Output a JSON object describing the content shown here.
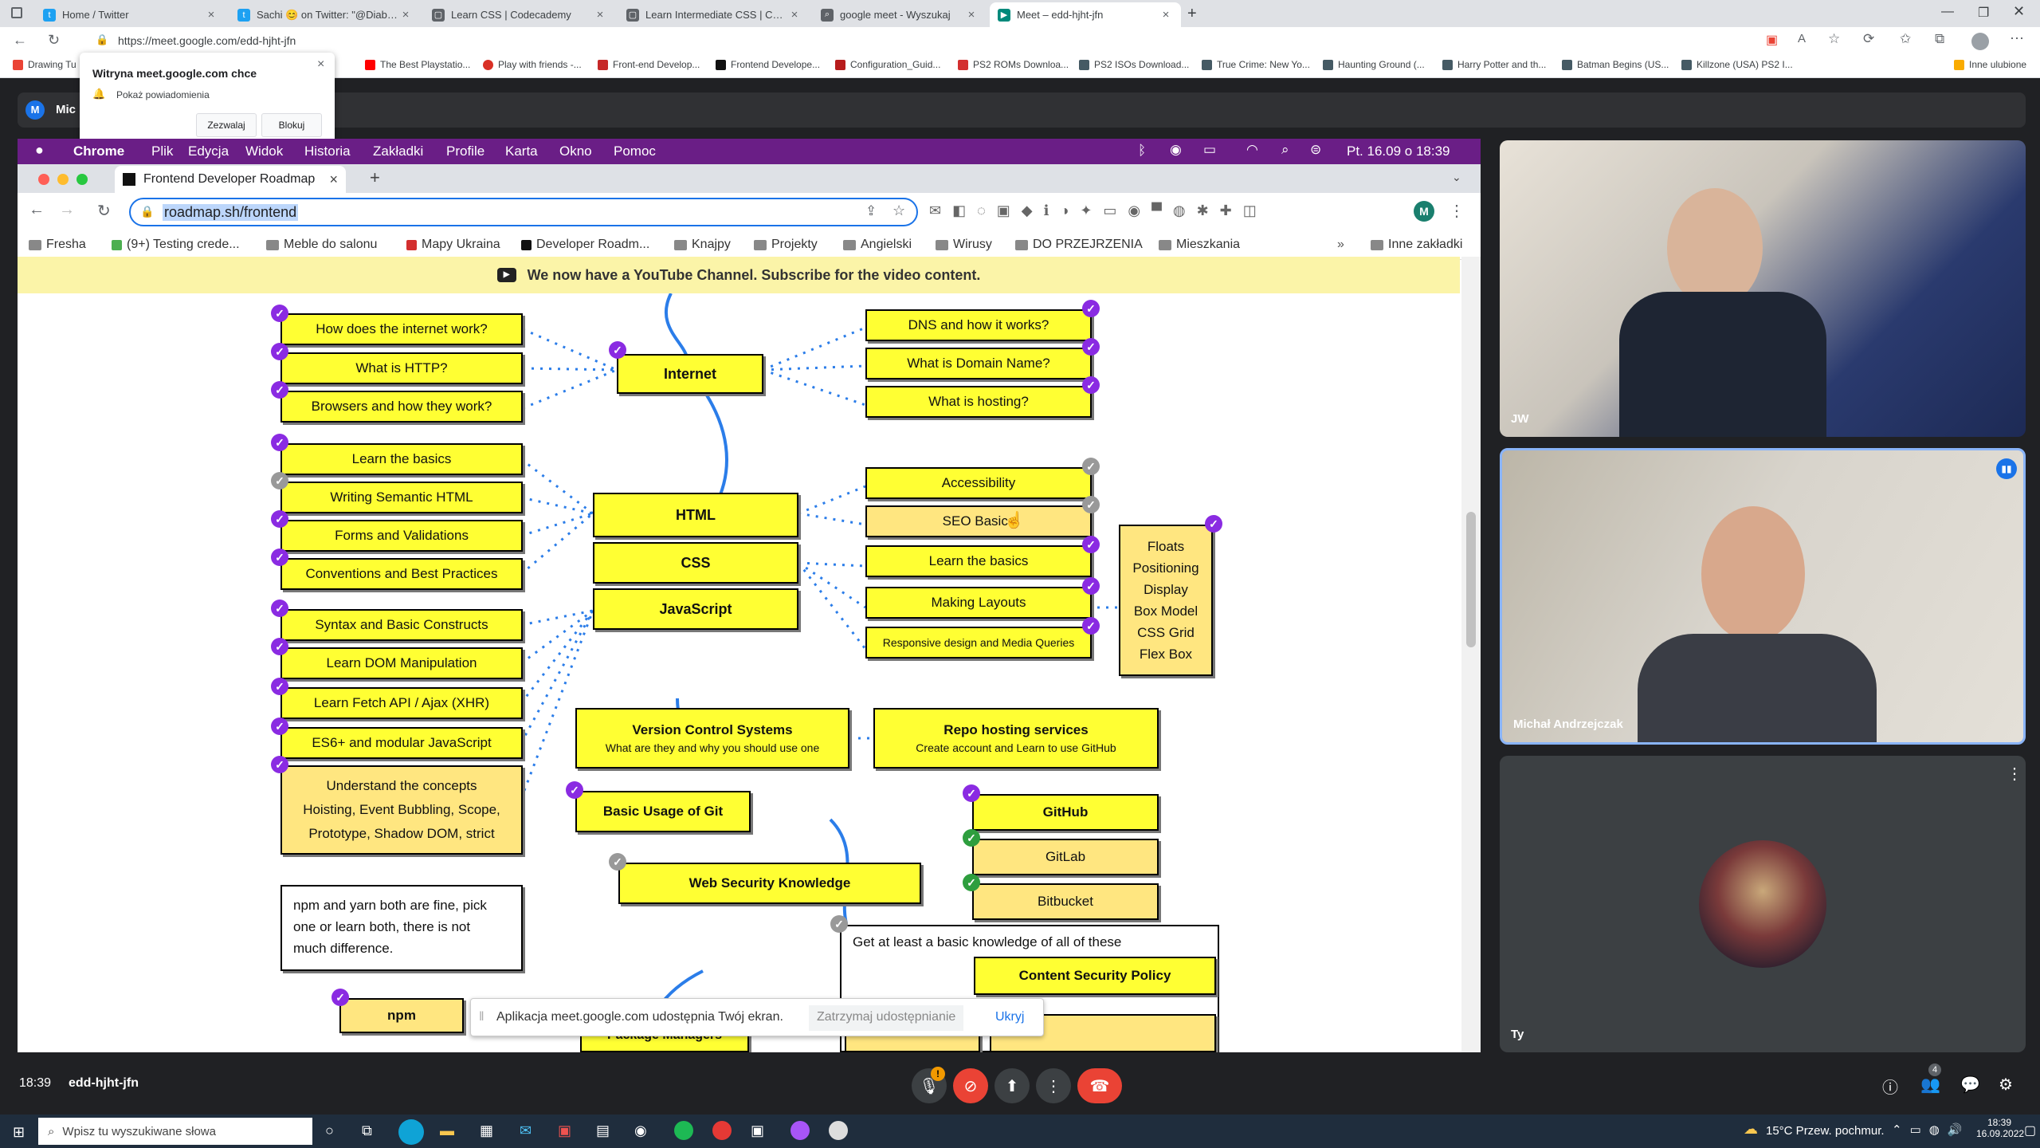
{
  "outer_tabs": [
    {
      "title": "Home / Twitter",
      "fav": "#1da1f2",
      "glyph": "t"
    },
    {
      "title": "Sachi 😊 on Twitter: \"@Diabellu",
      "fav": "#1da1f2",
      "glyph": "t"
    },
    {
      "title": "Learn CSS | Codecademy",
      "fav": "#5f6368",
      "glyph": "▢"
    },
    {
      "title": "Learn Intermediate CSS | Codeca",
      "fav": "#5f6368",
      "glyph": "▢"
    },
    {
      "title": "google meet - Wyszukaj",
      "fav": "#5f6368",
      "glyph": "⌕"
    },
    {
      "title": "Meet – edd-hjht-jfn",
      "fav": "#00897b",
      "glyph": "▶"
    }
  ],
  "outer_url": "https://meet.google.com/edd-hjht-jfn",
  "outer_bookmarks": [
    "Drawing Tu",
    "The Best Playstatio...",
    "Play with friends -...",
    "Front-end Develop...",
    "Frontend Develope...",
    "Configuration_Guid...",
    "PS2 ROMs Downloa...",
    "PS2 ISOs Download...",
    "True Crime: New Yo...",
    "Haunting Ground (...",
    "Harry Potter and th...",
    "Batman Begins (US...",
    "Killzone (USA) PS2 I..."
  ],
  "outer_bookmarks_other": "Inne ulubione",
  "notif": {
    "title": "Witryna meet.google.com chce",
    "item": "Pokaż powiadomienia",
    "allow": "Zezwalaj",
    "block": "Blokuj"
  },
  "meet_user_short": "Mic",
  "mac_menu": [
    "Chrome",
    "Plik",
    "Edycja",
    "Widok",
    "Historia",
    "Zakładki",
    "Profile",
    "Karta",
    "Okno",
    "Pomoc"
  ],
  "mac_clock": "Pt. 16.09 o 18:39",
  "inner_tab_title": "Frontend Developer Roadmap",
  "inner_url": "roadmap.sh/frontend",
  "inner_bookmarks": [
    "Fresha",
    "(9+) Testing crede...",
    "Meble do salonu",
    "Mapy Ukraina",
    "Developer Roadm...",
    "Knajpy",
    "Projekty",
    "Angielski",
    "Wirusy",
    "DO PRZEJRZENIA",
    "Mieszkania"
  ],
  "inner_bookmarks_other": "Inne zakładki",
  "yt_banner": "We now have a YouTube Channel. Subscribe for the video content.",
  "roadmap": {
    "internet": "Internet",
    "internet_left": [
      "How does the internet work?",
      "What is HTTP?",
      "Browsers and how they work?"
    ],
    "internet_right": [
      "DNS and how it works?",
      "What is Domain Name?",
      "What is hosting?"
    ],
    "html": "HTML",
    "css": "CSS",
    "js": "JavaScript",
    "html_left": [
      "Learn the basics",
      "Writing Semantic HTML",
      "Forms and Validations",
      "Conventions and Best Practices"
    ],
    "html_right": [
      "Accessibility",
      "SEO Basics"
    ],
    "css_right": [
      "Learn the basics",
      "Making Layouts",
      "Responsive design and Media Queries"
    ],
    "layout_list": [
      "Floats",
      "Positioning",
      "Display",
      "Box Model",
      "CSS Grid",
      "Flex Box"
    ],
    "js_left": [
      "Syntax and Basic Constructs",
      "Learn DOM Manipulation",
      "Learn Fetch API / Ajax (XHR)",
      "ES6+ and modular JavaScript"
    ],
    "js_concepts": [
      "Understand the concepts",
      "Hoisting, Event Bubbling, Scope,",
      "Prototype, Shadow DOM, strict"
    ],
    "vcs_title": "Version Control Systems",
    "vcs_sub": "What are they and why you should use one",
    "repo_title": "Repo hosting services",
    "repo_sub": "Create account and Learn to use GitHub",
    "git_basic": "Basic Usage of Git",
    "hosts": [
      "GitHub",
      "GitLab",
      "Bitbucket"
    ],
    "websec": "Web Security Knowledge",
    "npm_note": [
      "npm and yarn both are fine, pick",
      "one or learn both, there is not",
      "much difference."
    ],
    "npm": "npm",
    "pkg": "Package Managers",
    "sec_note": "Get at least a basic knowledge of all of these",
    "csp": "Content Security Policy"
  },
  "share_bar": {
    "text": "Aplikacja meet.google.com udostępnia Twój ekran.",
    "stop": "Zatrzymaj udostępnianie",
    "hide": "Ukryj"
  },
  "participants": [
    {
      "name": "JW"
    },
    {
      "name": "Michał Andrzejczak"
    },
    {
      "name": "Ty"
    }
  ],
  "meeting": {
    "time": "18:39",
    "code": "edd-hjht-jfn",
    "badge": "4"
  },
  "taskbar": {
    "search": "Wpisz tu wyszukiwane słowa",
    "weather": "15°C  Przew. pochmur.",
    "time": "18:39",
    "date": "16.09.2022"
  },
  "colors": {
    "mac_purple": "#6a1e86",
    "roadmap_yellow": "#ffff33",
    "check_purple": "#8a2be2",
    "banner": "#fbf4a8",
    "meet_red": "#ea4335"
  }
}
